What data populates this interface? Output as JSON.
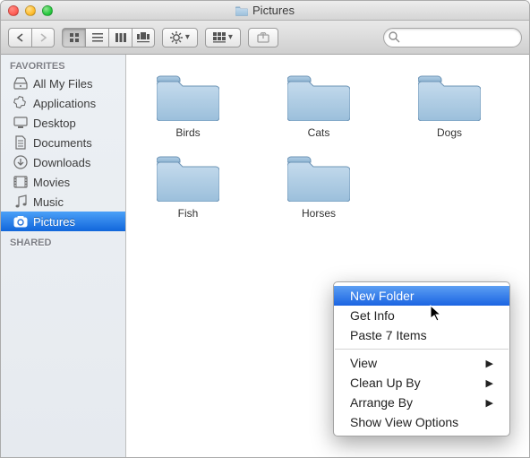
{
  "window": {
    "title": "Pictures"
  },
  "sidebar": {
    "sections": [
      {
        "title": "FAVORITES",
        "items": [
          {
            "label": "All My Files",
            "icon": "all-my-files"
          },
          {
            "label": "Applications",
            "icon": "applications"
          },
          {
            "label": "Desktop",
            "icon": "desktop"
          },
          {
            "label": "Documents",
            "icon": "documents"
          },
          {
            "label": "Downloads",
            "icon": "downloads"
          },
          {
            "label": "Movies",
            "icon": "movies"
          },
          {
            "label": "Music",
            "icon": "music"
          },
          {
            "label": "Pictures",
            "icon": "pictures",
            "selected": true
          }
        ]
      },
      {
        "title": "SHARED",
        "items": []
      }
    ]
  },
  "folders": [
    {
      "name": "Birds"
    },
    {
      "name": "Cats"
    },
    {
      "name": "Dogs"
    },
    {
      "name": "Fish"
    },
    {
      "name": "Horses"
    }
  ],
  "context_menu": {
    "items": [
      {
        "label": "New Folder",
        "highlighted": true
      },
      {
        "label": "Get Info"
      },
      {
        "label": "Paste 7 Items"
      },
      {
        "separator": true
      },
      {
        "label": "View",
        "submenu": true
      },
      {
        "label": "Clean Up By",
        "submenu": true
      },
      {
        "label": "Arrange By",
        "submenu": true
      },
      {
        "label": "Show View Options"
      }
    ]
  },
  "search": {
    "placeholder": ""
  }
}
